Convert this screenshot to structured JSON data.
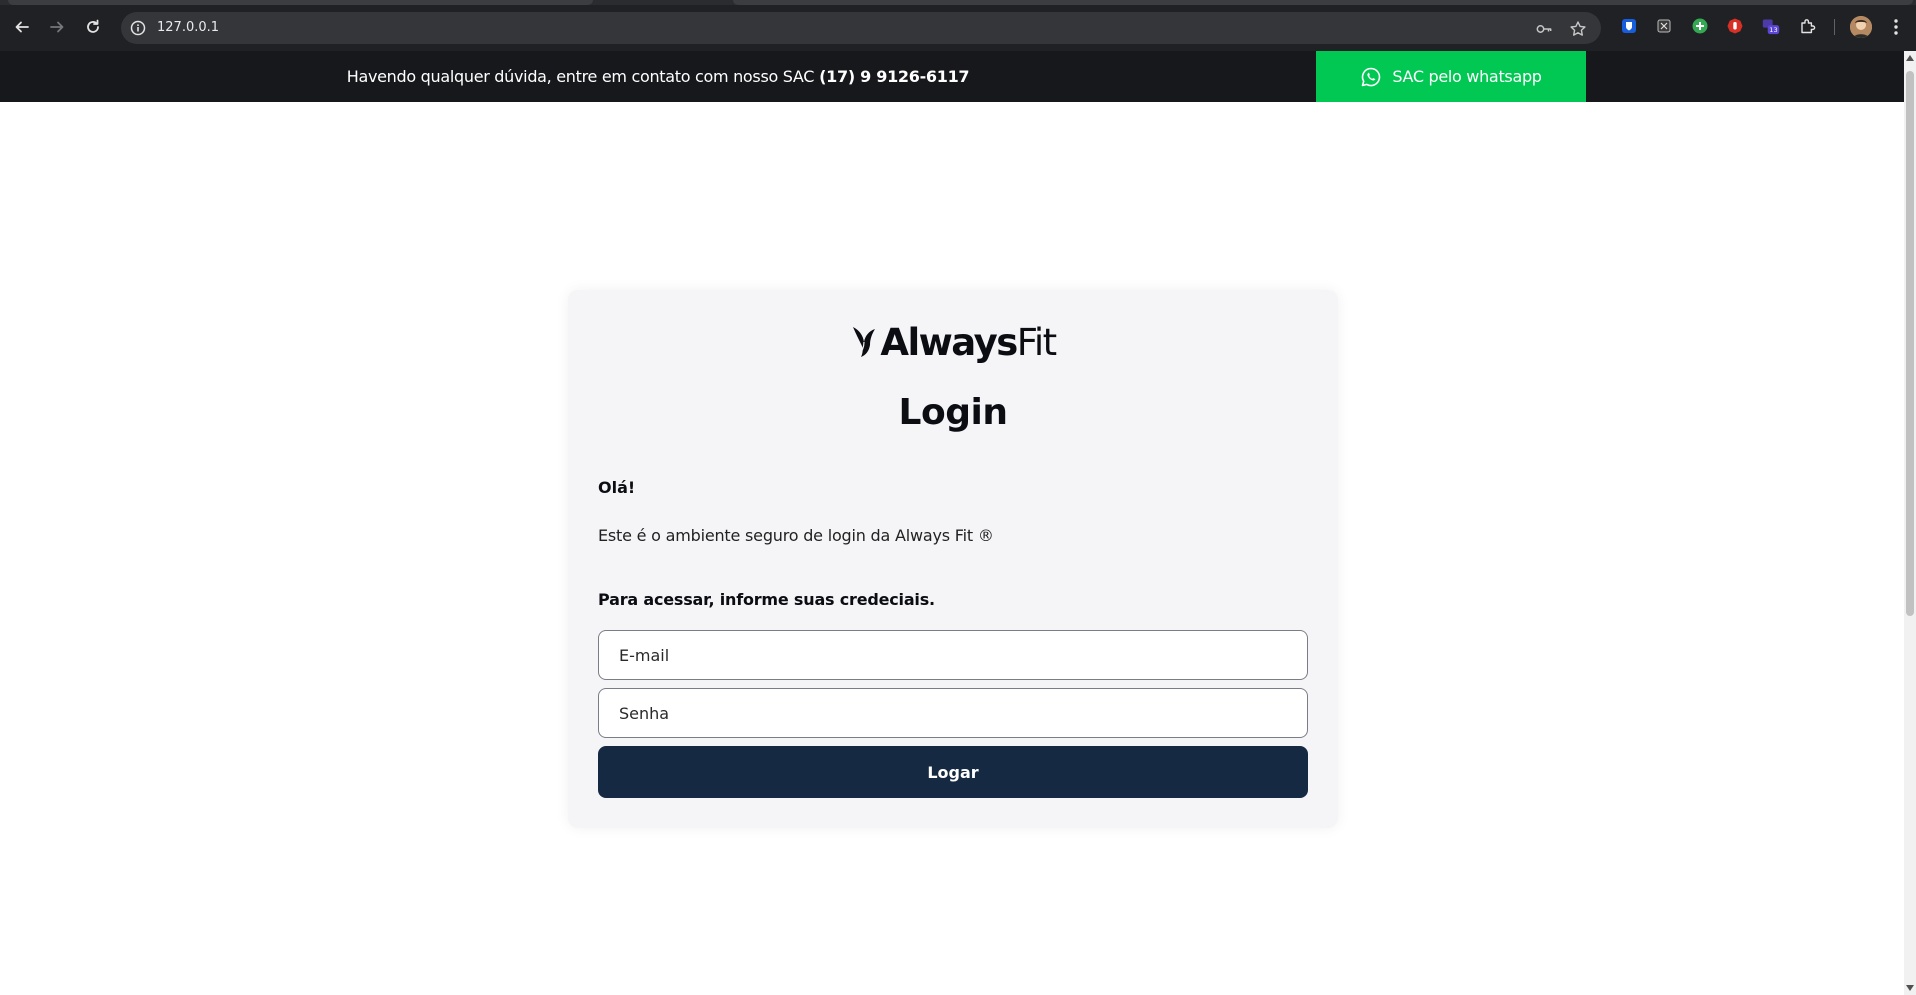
{
  "browser": {
    "url": "127.0.0.1",
    "extension_badge_count": "13",
    "icons": [
      "back-arrow-icon",
      "forward-arrow-icon",
      "reload-icon",
      "site-info-icon",
      "password-key-icon",
      "bookmark-star-icon",
      "extensions-puzzle-icon",
      "menu-kebab-icon"
    ]
  },
  "sac_bar": {
    "message": "Havendo qualquer dúvida, entre em contato com nosso SAC",
    "phone": "(17) 9 9126-6117",
    "whatsapp_label": "SAC pelo whatsapp",
    "background_color": "#16181c",
    "whatsapp_color": "#00c853"
  },
  "login": {
    "logo_strong": "Always",
    "logo_light": "Fit",
    "title": "Login",
    "greeting": "Olá!",
    "secure_text": "Este é o ambiente seguro de login da Always Fit ®",
    "instruction": "Para acessar, informe suas credeciais.",
    "email_placeholder": "E-mail",
    "password_placeholder": "Senha",
    "submit_label": "Logar",
    "button_color": "#152a42"
  }
}
